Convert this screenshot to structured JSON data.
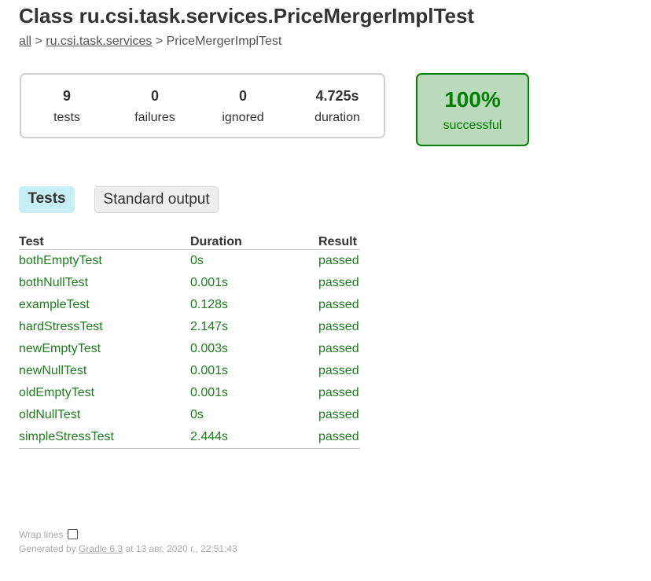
{
  "page": {
    "title": "Class ru.csi.task.services.PriceMergerImplTest"
  },
  "breadcrumb": {
    "all_link": "all",
    "sep1": " > ",
    "package_link": "ru.csi.task.services",
    "sep2": " > ",
    "current": "PriceMergerImplTest"
  },
  "summary": {
    "tests": {
      "value": "9",
      "label": "tests"
    },
    "failures": {
      "value": "0",
      "label": "failures"
    },
    "ignored": {
      "value": "0",
      "label": "ignored"
    },
    "duration": {
      "value": "4.725s",
      "label": "duration"
    },
    "success": {
      "value": "100%",
      "label": "successful"
    }
  },
  "tabs": [
    {
      "label": "Tests",
      "active": true
    },
    {
      "label": "Standard output",
      "active": false
    }
  ],
  "table": {
    "headers": [
      "Test",
      "Duration",
      "Result"
    ],
    "rows": [
      {
        "test": "bothEmptyTest",
        "duration": "0s",
        "result": "passed"
      },
      {
        "test": "bothNullTest",
        "duration": "0.001s",
        "result": "passed"
      },
      {
        "test": "exampleTest",
        "duration": "0.128s",
        "result": "passed"
      },
      {
        "test": "hardStressTest",
        "duration": "2.147s",
        "result": "passed"
      },
      {
        "test": "newEmptyTest",
        "duration": "0.003s",
        "result": "passed"
      },
      {
        "test": "newNullTest",
        "duration": "0.001s",
        "result": "passed"
      },
      {
        "test": "oldEmptyTest",
        "duration": "0.001s",
        "result": "passed"
      },
      {
        "test": "oldNullTest",
        "duration": "0s",
        "result": "passed"
      },
      {
        "test": "simpleStressTest",
        "duration": "2.444s",
        "result": "passed"
      }
    ]
  },
  "footer": {
    "wrap_label": "Wrap lines",
    "generated_prefix": "Generated by ",
    "gradle_link": "Gradle 6.3",
    "generated_suffix": " at 13 авг. 2020 г., 22:51:43"
  },
  "colors": {
    "success_green": "#008000",
    "success_bg": "#bbd9bb",
    "passed_text": "#1b7d1b",
    "active_tab_bg": "#c6eff5"
  }
}
